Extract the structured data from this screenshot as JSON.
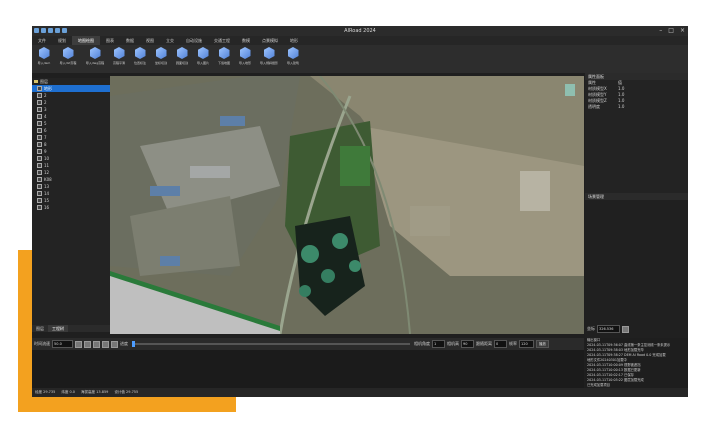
{
  "window": {
    "title": "AIRoad 2024"
  },
  "menu": [
    "文件",
    "规划",
    "地图绘图",
    "图表",
    "数据",
    "视图",
    "立交",
    "自动设施",
    "交通工程",
    "数模",
    "点景模拟",
    "地形"
  ],
  "menu_active": 2,
  "ribbon": [
    "导入dem",
    "导入dxf高程",
    "导入dwg高程",
    "高程平滑",
    "位置标注",
    "坐标切割",
    "圆面切割",
    "导入图片",
    "下载地图",
    "导入地形",
    "导入倾斜摄影",
    "导入建筑"
  ],
  "tree": {
    "root": "图层",
    "selected": "地形",
    "items": [
      "2",
      "2",
      "3",
      "4",
      "5",
      "6",
      "7",
      "8",
      "9",
      "10",
      "11",
      "12",
      "K08",
      "13",
      "14",
      "15",
      "16"
    ]
  },
  "left_tabs": [
    "图层",
    "工程树"
  ],
  "properties": {
    "header": "属性面板",
    "col_key": "属性",
    "col_val": "值",
    "rows": [
      {
        "k": "材质模型X",
        "v": "1.0"
      },
      {
        "k": "材质模型Y",
        "v": "1.0"
      },
      {
        "k": "材质模型Z",
        "v": "1.0"
      },
      {
        "k": "透明度",
        "v": "1.0"
      }
    ],
    "section2": "场景管理"
  },
  "coord": {
    "label": "坐标",
    "value": "326.536"
  },
  "timeline": {
    "speed_label": "时间流速",
    "speed_value": "50.0",
    "progress_label": "进度",
    "angle_label": "相机角度",
    "angle_value": "1",
    "height_label": "相机高",
    "height_value": "90",
    "dist_label": "跟随距离",
    "dist_value": "0",
    "fps_label": "帧率",
    "fps_value": "120",
    "play_label": "播放",
    "progress": 0.0
  },
  "log": {
    "header": "输出窗口",
    "lines": [
      "2024-03-11T09:36:07 曲线第一条主控测线一条未提示",
      "2024-03-11T09:38:03 地形加载完毕",
      "2024-03-11T09:38:27 DEM AI Road 0.0 完成加载",
      "地形文件20240301加载中",
      "2024-03-11T10:00:09 视野被遮挡",
      "2024-03-11T10:00:13 数据已更新",
      "2024-03-11T10:02:17 已保存",
      "2024-03-11T10:05:22 图层加载完成",
      "已完成加载项目",
      "=== 已加载所有地形 ==="
    ]
  },
  "status": [
    "经度 29.735",
    "纬度 0.0",
    "海拔高度 13.859",
    "设计值 29.755"
  ],
  "colors": {
    "accent": "#f3a11f",
    "selection": "#1e6fd0",
    "app_bg": "#1f1f1f"
  }
}
